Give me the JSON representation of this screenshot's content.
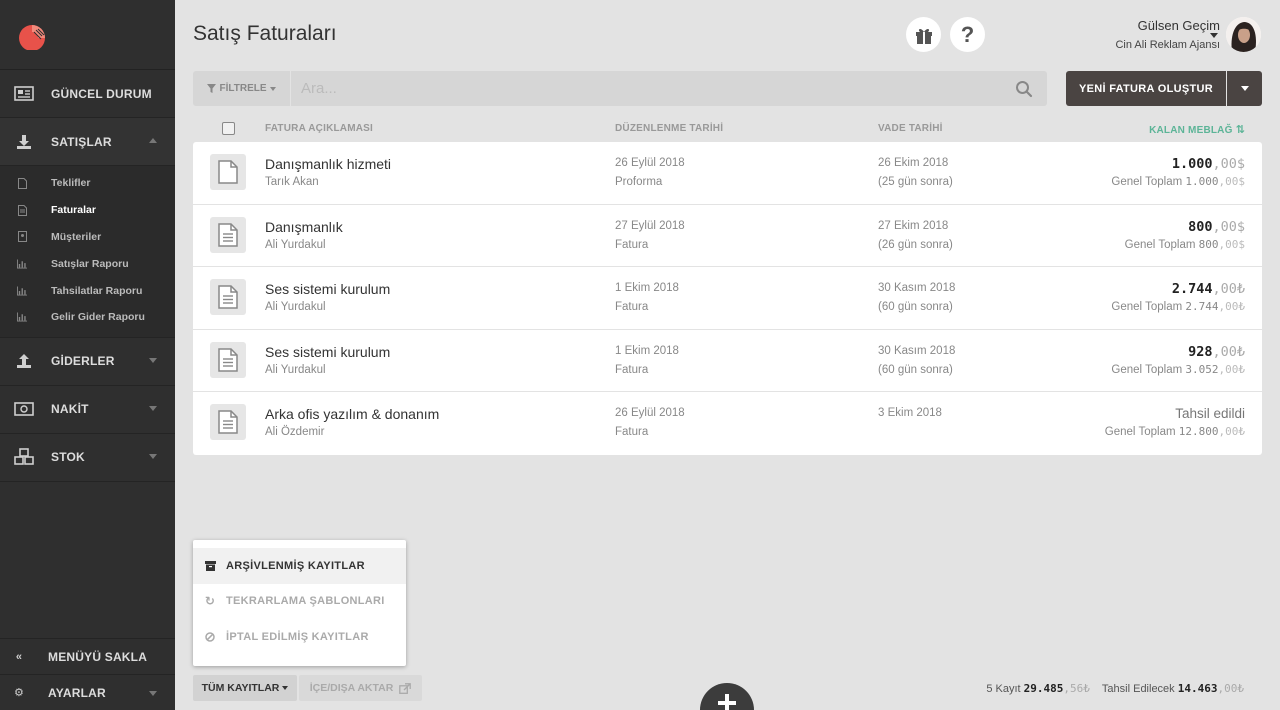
{
  "sidebar": {
    "sections": [
      {
        "label": "GÜNCEL DURUM",
        "icon": "newspaper-icon"
      },
      {
        "label": "SATIŞLAR",
        "icon": "download-icon"
      },
      {
        "label": "GİDERLER",
        "icon": "upload-icon"
      },
      {
        "label": "NAKİT",
        "icon": "money-icon"
      },
      {
        "label": "STOK",
        "icon": "cubes-icon"
      }
    ],
    "sales_items": [
      {
        "label": "Teklifler"
      },
      {
        "label": "Faturalar"
      },
      {
        "label": "Müşteriler"
      },
      {
        "label": "Satışlar Raporu"
      },
      {
        "label": "Tahsilatlar Raporu"
      },
      {
        "label": "Gelir Gider Raporu"
      }
    ],
    "hide_menu": "MENÜYÜ SAKLA",
    "settings": "AYARLAR"
  },
  "header": {
    "title": "Satış Faturaları",
    "user_name": "Gülsen Geçim",
    "company": "Cin Ali Reklam Ajansı"
  },
  "toolbar": {
    "filter_label": "FİLTRELE",
    "search_placeholder": "Ara...",
    "new_invoice_label": "YENİ FATURA OLUŞTUR"
  },
  "table": {
    "headers": {
      "description": "FATURA AÇIKLAMASI",
      "issue_date": "DÜZENLENME TARİHİ",
      "due_date": "VADE TARİHİ",
      "remaining": "KALAN MEBLAĞ"
    },
    "rows": [
      {
        "description": "Danışmanlık hizmeti",
        "client": "Tarık Akan",
        "issue_date": "26 Eylül 2018",
        "type": "Proforma",
        "due_date": "26 Ekim 2018",
        "due_note": "(25 gün sonra)",
        "amount_int": "1.000",
        "amount_dec": ",00$",
        "total_label": "Genel Toplam",
        "total_int": "1.000",
        "total_dec": ",00$"
      },
      {
        "description": "Danışmanlık",
        "client": "Ali Yurdakul",
        "issue_date": "27 Eylül 2018",
        "type": "Fatura",
        "due_date": "27 Ekim 2018",
        "due_note": "(26 gün sonra)",
        "amount_int": "800",
        "amount_dec": ",00$",
        "total_label": "Genel Toplam",
        "total_int": "800",
        "total_dec": ",00$"
      },
      {
        "description": "Ses sistemi kurulum",
        "client": "Ali Yurdakul",
        "issue_date": "1 Ekim 2018",
        "type": "Fatura",
        "due_date": "30 Kasım 2018",
        "due_note": "(60 gün sonra)",
        "amount_int": "2.744",
        "amount_dec": ",00₺",
        "total_label": "Genel Toplam",
        "total_int": "2.744",
        "total_dec": ",00₺"
      },
      {
        "description": "Ses sistemi kurulum",
        "client": "Ali Yurdakul",
        "issue_date": "1 Ekim 2018",
        "type": "Fatura",
        "due_date": "30 Kasım 2018",
        "due_note": "(60 gün sonra)",
        "amount_int": "928",
        "amount_dec": ",00₺",
        "total_label": "Genel Toplam",
        "total_int": "3.052",
        "total_dec": ",00₺"
      },
      {
        "description": "Arka ofis yazılım & donanım",
        "client": "Ali Özdemir",
        "issue_date": "26 Eylül 2018",
        "type": "Fatura",
        "due_date": "3 Ekim 2018",
        "due_note": "",
        "amount_int": "Tahsil edildi",
        "amount_dec": "",
        "total_label": "Genel Toplam",
        "total_int": "12.800",
        "total_dec": ",00₺"
      }
    ]
  },
  "popup_menu": {
    "items": [
      {
        "label": "ARŞİVLENMİŞ KAYITLAR",
        "icon": "archive-icon"
      },
      {
        "label": "TEKRARLAMA ŞABLONLARI",
        "icon": "repeat-icon"
      },
      {
        "label": "İPTAL EDİLMİŞ KAYITLAR",
        "icon": "ban-icon"
      }
    ]
  },
  "footer": {
    "all_records": "TÜM KAYITLAR",
    "import_export": "İÇE/DIŞA AKTAR",
    "count_label": "5 Kayıt",
    "sum_int": "29.485",
    "sum_dec": ",56₺",
    "collectable_label": "Tahsil Edilecek",
    "collectable_int": "14.463",
    "collectable_dec": ",00₺"
  },
  "colors": {
    "sidebar_bg": "#2f2f2f",
    "page_bg": "#e3e3e3",
    "primary_btn": "#4a4442",
    "accent_green": "#5cb497",
    "logo_red": "#e8524a"
  }
}
